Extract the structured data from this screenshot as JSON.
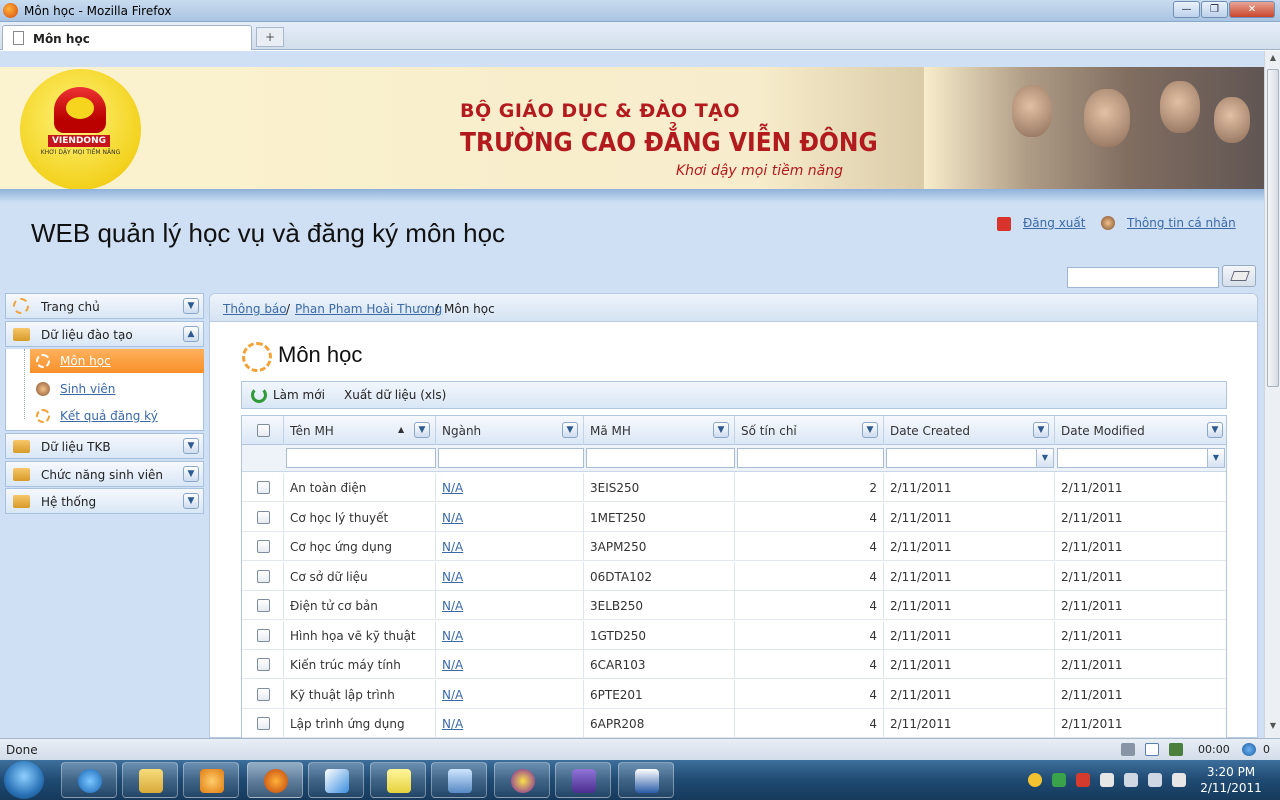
{
  "window": {
    "title": "Môn học - Mozilla Firefox",
    "tab_label": "Môn học",
    "new_tab_glyph": "+",
    "min_glyph": "—",
    "max_glyph": "❐",
    "close_glyph": "✕"
  },
  "banner": {
    "logo_text": "VIENDONG",
    "logo_slogan": "KHƠI DẬY MỌI TIỀM NĂNG",
    "line1": "BỘ GIÁO DỤC & ĐÀO TẠO",
    "line2": "TRƯỜNG CAO ĐẲNG VIỄN ĐÔNG",
    "line3": "Khơi dậy mọi tiềm năng"
  },
  "header": {
    "app_title": "WEB quản lý học vụ và đăng ký môn học",
    "logout_label": "Đăng xuất",
    "profile_label": "Thông tin cá nhân",
    "search_value": ""
  },
  "sidebar": {
    "sections": [
      {
        "label": "Trang chủ"
      },
      {
        "label": "Dữ liệu đào tạo"
      },
      {
        "label": "Dữ liệu TKB"
      },
      {
        "label": "Chức năng sinh viên"
      },
      {
        "label": "Hệ thống"
      }
    ],
    "sub_items": [
      {
        "label": "Môn học"
      },
      {
        "label": "Sinh viên"
      },
      {
        "label": "Kết quả đăng ký"
      }
    ]
  },
  "breadcrumb": {
    "item1": "Thông báo",
    "sep": "/",
    "item2": "Phan Pham Hoài Thương",
    "current": "Môn học"
  },
  "page": {
    "title": "Môn học",
    "refresh_label": "Làm mới",
    "export_label": "Xuất dữ liệu (xls)"
  },
  "grid": {
    "columns": [
      "Tên MH",
      "Ngành",
      "Mã MH",
      "Số tín chỉ",
      "Date Created",
      "Date Modified"
    ],
    "sort_glyph": "▲",
    "dropdown_glyph": "▼",
    "rows": [
      {
        "name": "An toàn điện",
        "major": "N/A",
        "code": "3EIS250",
        "credits": "2",
        "created": "2/11/2011",
        "modified": "2/11/2011"
      },
      {
        "name": "Cơ học lý thuyết",
        "major": "N/A",
        "code": "1MET250",
        "credits": "4",
        "created": "2/11/2011",
        "modified": "2/11/2011"
      },
      {
        "name": "Cơ học ứng dụng",
        "major": "N/A",
        "code": "3APM250",
        "credits": "4",
        "created": "2/11/2011",
        "modified": "2/11/2011"
      },
      {
        "name": "Cơ sở dữ liệu",
        "major": "N/A",
        "code": "06DTA102",
        "credits": "4",
        "created": "2/11/2011",
        "modified": "2/11/2011"
      },
      {
        "name": "Điện tử cơ bản",
        "major": "N/A",
        "code": "3ELB250",
        "credits": "4",
        "created": "2/11/2011",
        "modified": "2/11/2011"
      },
      {
        "name": "Hình họa vẽ kỹ thuật",
        "major": "N/A",
        "code": "1GTD250",
        "credits": "4",
        "created": "2/11/2011",
        "modified": "2/11/2011"
      },
      {
        "name": "Kiến trúc máy tính",
        "major": "N/A",
        "code": "6CAR103",
        "credits": "4",
        "created": "2/11/2011",
        "modified": "2/11/2011"
      },
      {
        "name": "Kỹ thuật lập trình",
        "major": "N/A",
        "code": "6PTE201",
        "credits": "4",
        "created": "2/11/2011",
        "modified": "2/11/2011"
      },
      {
        "name": "Lập trình ứng dụng",
        "major": "N/A",
        "code": "6APR208",
        "credits": "4",
        "created": "2/11/2011",
        "modified": "2/11/2011"
      }
    ]
  },
  "statusbar": {
    "status": "Done",
    "timer": "00:00",
    "count": "0"
  },
  "taskbar": {
    "time": "3:20 PM",
    "date": "2/11/2011"
  }
}
